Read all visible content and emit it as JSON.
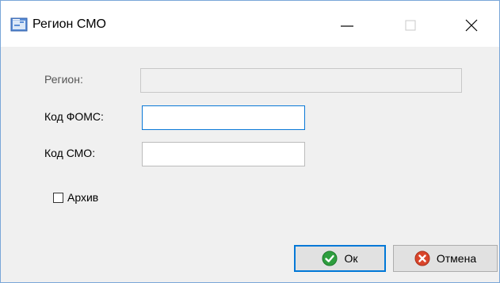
{
  "window": {
    "title": "Регион СМО"
  },
  "form": {
    "region_label": "Регион:",
    "region_value": "",
    "foms_label": "Код ФОМС:",
    "foms_value": "",
    "smo_label": "Код СМО:",
    "smo_value": "",
    "archive_label": "Архив",
    "archive_checked": false
  },
  "buttons": {
    "ok_label": "Ок",
    "cancel_label": "Отмена"
  },
  "colors": {
    "focus_border": "#0078d7",
    "ok_icon": "#2e9e3e",
    "cancel_icon": "#d9452b"
  }
}
